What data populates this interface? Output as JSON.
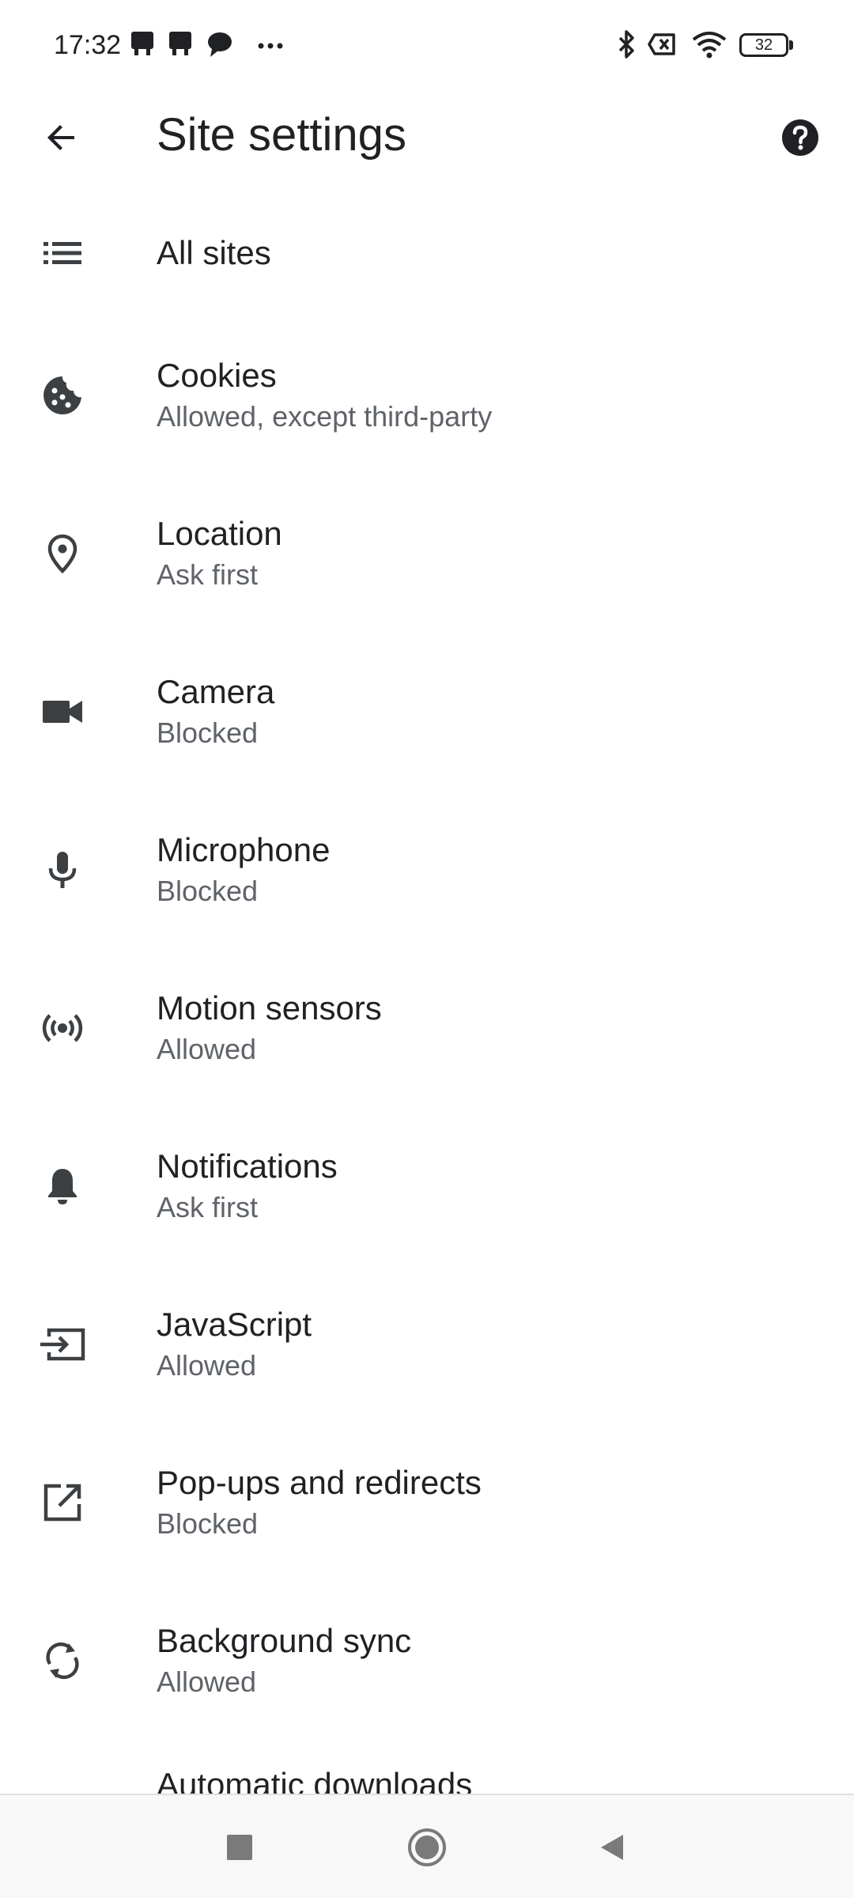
{
  "status_bar": {
    "time": "17:32",
    "battery_level": "32",
    "left_icons": [
      "notification-app-icon",
      "notification-app-icon",
      "chat-bubble-icon",
      "more-dots-icon"
    ],
    "right_icons": [
      "bluetooth-icon",
      "no-sim-icon",
      "wifi-icon",
      "battery-icon"
    ]
  },
  "app_bar": {
    "title": "Site settings",
    "back_icon": "arrow-back-icon",
    "help_icon": "help-circle-icon"
  },
  "settings": [
    {
      "title": "All sites",
      "subtitle": "",
      "icon": "list-icon"
    },
    {
      "title": "Cookies",
      "subtitle": "Allowed, except third-party",
      "icon": "cookie-icon"
    },
    {
      "title": "Location",
      "subtitle": "Ask first",
      "icon": "location-pin-icon"
    },
    {
      "title": "Camera",
      "subtitle": "Blocked",
      "icon": "videocam-icon"
    },
    {
      "title": "Microphone",
      "subtitle": "Blocked",
      "icon": "mic-icon"
    },
    {
      "title": "Motion sensors",
      "subtitle": "Allowed",
      "icon": "sensors-icon"
    },
    {
      "title": "Notifications",
      "subtitle": "Ask first",
      "icon": "bell-icon"
    },
    {
      "title": "JavaScript",
      "subtitle": "Allowed",
      "icon": "input-icon"
    },
    {
      "title": "Pop-ups and redirects",
      "subtitle": "Blocked",
      "icon": "open-in-new-icon"
    },
    {
      "title": "Background sync",
      "subtitle": "Allowed",
      "icon": "sync-icon"
    }
  ],
  "partial_item": {
    "title": "Automatic downloads"
  },
  "nav_bar": {
    "icons": [
      "recents-square-icon",
      "home-circle-icon",
      "back-triangle-icon"
    ]
  },
  "colors": {
    "text_primary": "#202124",
    "text_secondary": "#5f6368",
    "icon": "#3c4043",
    "nav_bg": "#f8f8f8"
  }
}
